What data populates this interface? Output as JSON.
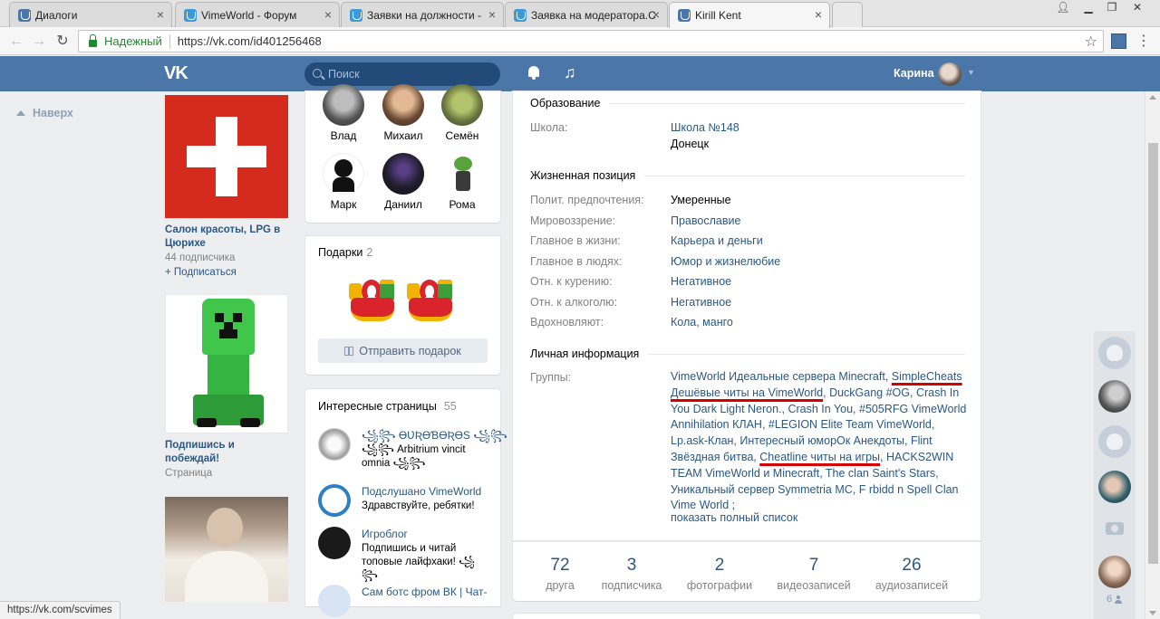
{
  "browser": {
    "tabs": [
      {
        "label": "Диалоги",
        "icon": "vk"
      },
      {
        "label": "VimeWorld - Форум",
        "icon": "vime"
      },
      {
        "label": "Заявки на должности - ",
        "icon": "vime"
      },
      {
        "label": "Заявка на модератора.С",
        "icon": "vime"
      },
      {
        "label": "Kirill Kent",
        "icon": "vk"
      }
    ],
    "secure_label": "Надежный",
    "url": "https://vk.com/id401256468",
    "status_url": "https://vk.com/scvimes"
  },
  "header": {
    "logo": "VK",
    "search_placeholder": "Поиск",
    "user_name": "Карина"
  },
  "left_nav": {
    "top_link": "Наверх"
  },
  "ads": [
    {
      "title": "Салон красоты, LPG в Цюрихе",
      "meta": "44 подписчика",
      "action": "+ Подписаться"
    },
    {
      "title": "Подпишись и побеждай!",
      "meta": "Страница"
    }
  ],
  "friends": [
    {
      "name": "Влад",
      "color": "#4b4b4b"
    },
    {
      "name": "Михаил",
      "color": "#8c6a4f"
    },
    {
      "name": "Семён",
      "color": "#6e7a52"
    },
    {
      "name": "Марк",
      "color": "#f2f2f2"
    },
    {
      "name": "Даниил",
      "color": "#2a2a38"
    },
    {
      "name": "Рома",
      "color": "#ffffff"
    }
  ],
  "gifts": {
    "title": "Подарки",
    "count": "2",
    "send_label": "Отправить подарок"
  },
  "pages": {
    "title": "Интересные страницы",
    "count": "55",
    "items": [
      {
        "name": "꧁꧂ ƟƲƦƟƁƟƦƟЅ ꧁꧂",
        "desc": "꧁꧂ Arbitrium vincit omnia ꧁꧂",
        "color": "#d9d9d9"
      },
      {
        "name": "Подслушано VimeWorld",
        "desc": "Здравствуйте, ребятки!",
        "color": "#2f7fc3"
      },
      {
        "name": "Игроблог",
        "desc": "Подпишись и читай топовые лайфхаки! ꧁꧂",
        "color": "#1a1a1a"
      },
      {
        "name": "Сам ботс фром ВК | Чат-",
        "desc": "",
        "color": "#5f8fc4"
      }
    ]
  },
  "profile": {
    "education": {
      "title": "Образование",
      "rows": [
        {
          "label": "Школа:",
          "value": "Школа №148",
          "value2": "Донецк"
        }
      ]
    },
    "life_position": {
      "title": "Жизненная позиция",
      "rows": [
        {
          "label": "Полит. предпочтения:",
          "value": "Умеренные"
        },
        {
          "label": "Мировоззрение:",
          "value": "Православие"
        },
        {
          "label": "Главное в жизни:",
          "value": "Карьера и деньги"
        },
        {
          "label": "Главное в людях:",
          "value": "Юмор и жизнелюбие"
        },
        {
          "label": "Отн. к курению:",
          "value": "Негативное"
        },
        {
          "label": "Отн. к алкоголю:",
          "value": "Негативное"
        },
        {
          "label": "Вдохновляют:",
          "value": "Кола, манго"
        }
      ]
    },
    "personal": {
      "title": "Личная информация",
      "groups_label": "Группы:",
      "groups_segments": [
        {
          "text": "VimeWorld Идеальные сервера Minecraft, ",
          "highlight": false
        },
        {
          "text": "SimpleCheats Дешёвые читы на VimeWorld",
          "highlight": true
        },
        {
          "text": ", DuckGang #OG, Crash In You Dark Light Neron., Crash In You, #505RFG VimeWorld Annihilation КЛАН, #LEGION Elite Team VimeWorld, Lp.ask-Клан, Интересный юморОк Анекдоты, Flint Звёздная битва, ",
          "highlight": false
        },
        {
          "text": "Cheatline читы на игры",
          "highlight": true
        },
        {
          "text": ", HACKS2WIN TEAM VimeWorld и Minecraft, The clan Saint's Stars, Уникальный сервер Symmetria MC, F rbidd n Spell Clan Vime World ;",
          "highlight": false
        }
      ],
      "show_all": "показать полный список"
    }
  },
  "stats": [
    {
      "num": "72",
      "label": "друга"
    },
    {
      "num": "3",
      "label": "подписчика"
    },
    {
      "num": "2",
      "label": "фотографии"
    },
    {
      "num": "7",
      "label": "видеозаписей"
    },
    {
      "num": "26",
      "label": "аудиозаписей"
    }
  ],
  "online_sidebar": {
    "count": "6"
  },
  "colors": {
    "vk_blue": "#4a76a8",
    "link": "#2a5885",
    "highlight_underline": "#d40000"
  }
}
